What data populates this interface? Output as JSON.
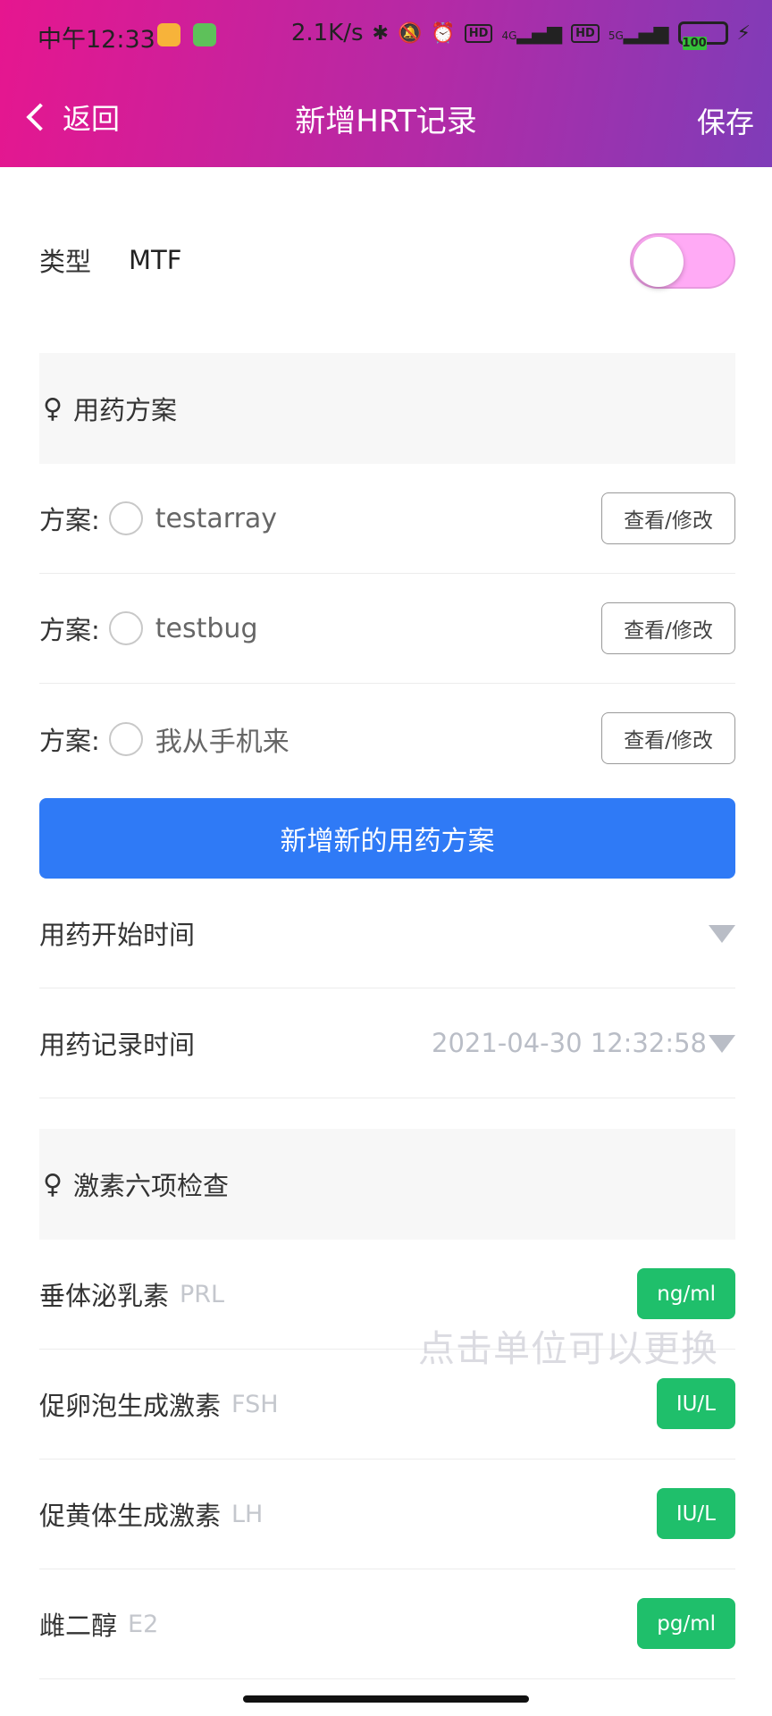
{
  "status_bar": {
    "time": "中午12:33",
    "net_speed": "2.1K/s",
    "hd1": "HD",
    "hd2": "HD",
    "signal1": "4G",
    "signal2": "5G",
    "battery": "100"
  },
  "header": {
    "back_label": "返回",
    "title": "新增HRT记录",
    "save_label": "保存"
  },
  "type_row": {
    "label": "类型",
    "value": "MTF"
  },
  "plan_section": {
    "icon": "♀",
    "title": "用药方案",
    "plans": [
      {
        "prefix": "方案:",
        "name": "testarray",
        "button": "查看/修改"
      },
      {
        "prefix": "方案:",
        "name": "testbug",
        "button": "查看/修改"
      },
      {
        "prefix": "方案:",
        "name": "我从手机来",
        "button": "查看/修改"
      }
    ],
    "add_button": "新增新的用药方案"
  },
  "start_time": {
    "label": "用药开始时间",
    "value": ""
  },
  "record_time": {
    "label": "用药记录时间",
    "value": "2021-04-30 12:32:58"
  },
  "hormone_section": {
    "icon": "♀",
    "title": "激素六项检查",
    "items": [
      {
        "name": "垂体泌乳素",
        "abbr": "PRL",
        "unit": "ng/ml"
      },
      {
        "name": "促卵泡生成激素",
        "abbr": "FSH",
        "unit": "IU/L"
      },
      {
        "name": "促黄体生成激素",
        "abbr": "LH",
        "unit": "IU/L"
      },
      {
        "name": "雌二醇",
        "abbr": "E2",
        "unit": "pg/ml"
      }
    ],
    "hint": "点击单位可以更换"
  },
  "colors": {
    "header_start": "#e6168f",
    "header_end": "#7f3cb8",
    "primary_button": "#2f7af6",
    "unit_button": "#1fbf6b",
    "toggle_track": "#ffaaf5"
  }
}
